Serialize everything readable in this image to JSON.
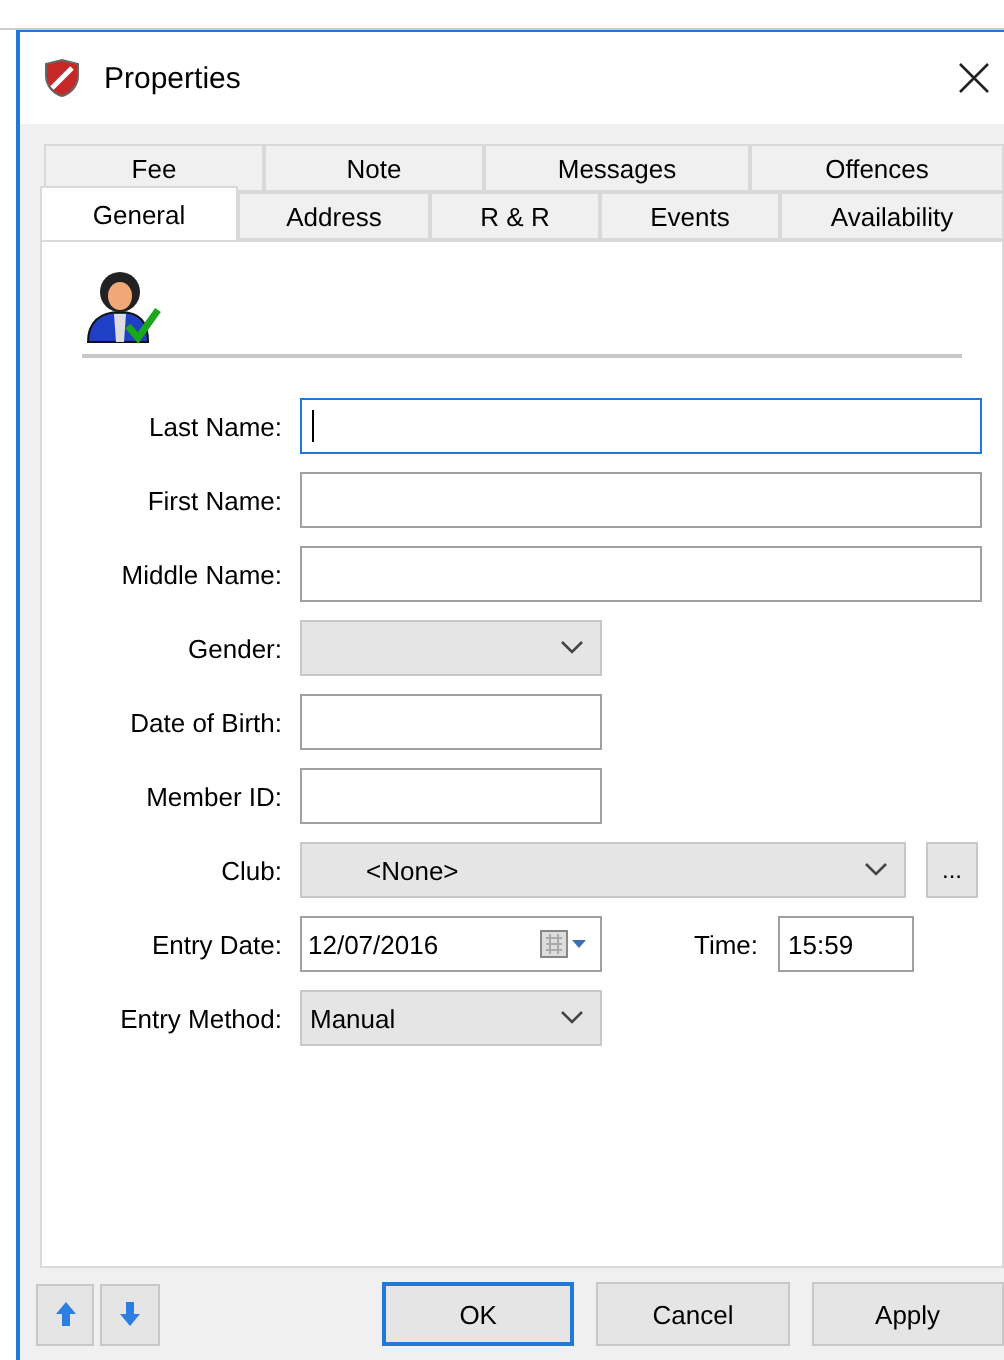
{
  "window": {
    "title": "Properties"
  },
  "tab_rows": [
    [
      {
        "label": "Fee",
        "selected": false
      },
      {
        "label": "Note",
        "selected": false
      },
      {
        "label": "Messages",
        "selected": false
      },
      {
        "label": "Offences",
        "selected": false
      }
    ],
    [
      {
        "label": "General",
        "selected": true
      },
      {
        "label": "Address",
        "selected": false
      },
      {
        "label": "R & R",
        "selected": false
      },
      {
        "label": "Events",
        "selected": false
      },
      {
        "label": "Availability",
        "selected": false
      }
    ]
  ],
  "fields": [
    {
      "label": "Last Name:",
      "kind": "text",
      "wide": true,
      "focused": true
    },
    {
      "label": "First Name:",
      "kind": "text",
      "wide": true,
      "focused": false
    },
    {
      "label": "Middle Name:",
      "kind": "text",
      "wide": true,
      "focused": false
    },
    {
      "label": "Gender:",
      "kind": "combo",
      "wide": false
    },
    {
      "label": "Date of Birth:",
      "kind": "text",
      "wide": false,
      "focused": false
    },
    {
      "label": "Member ID:",
      "kind": "text",
      "wide": false,
      "focused": false
    },
    {
      "label": "Club:",
      "kind": "combo",
      "wide": true,
      "value": "<None>",
      "browse": "..."
    },
    {
      "label": "Entry Date:",
      "kind": "date",
      "value": "12/07/2016",
      "time_label": "Time:",
      "time_value": "15:59"
    },
    {
      "label": "Entry Method:",
      "kind": "combo",
      "wide": false,
      "value": "Manual"
    }
  ],
  "buttons": [
    {
      "label": "OK",
      "default": true
    },
    {
      "label": "Cancel",
      "default": false
    },
    {
      "label": "Apply",
      "default": false
    }
  ]
}
